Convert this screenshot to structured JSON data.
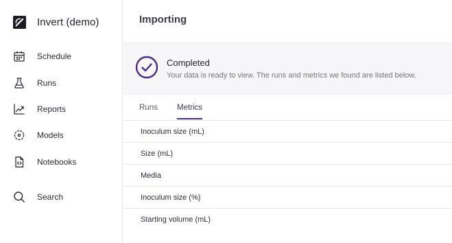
{
  "brand": {
    "name": "Invert (demo)"
  },
  "sidebar": {
    "items": [
      {
        "label": "Schedule",
        "icon": "calendar-icon"
      },
      {
        "label": "Runs",
        "icon": "flask-icon"
      },
      {
        "label": "Reports",
        "icon": "trend-chart-icon"
      },
      {
        "label": "Models",
        "icon": "models-icon"
      },
      {
        "label": "Notebooks",
        "icon": "notebook-icon"
      }
    ],
    "search": {
      "label": "Search",
      "icon": "search-icon"
    }
  },
  "main": {
    "title": "Importing",
    "status": {
      "title": "Completed",
      "description": "Your data is ready to view. The runs and metrics we found are listed below.",
      "icon": "check-circle-icon",
      "accent_color": "#4b2a86"
    },
    "tabs": [
      {
        "label": "Runs",
        "active": false
      },
      {
        "label": "Metrics",
        "active": true
      }
    ],
    "metrics": [
      "Inoculum size (mL)",
      "Size (mL)",
      "Media",
      "Inoculum size (%)",
      "Starting volume (mL)"
    ]
  }
}
